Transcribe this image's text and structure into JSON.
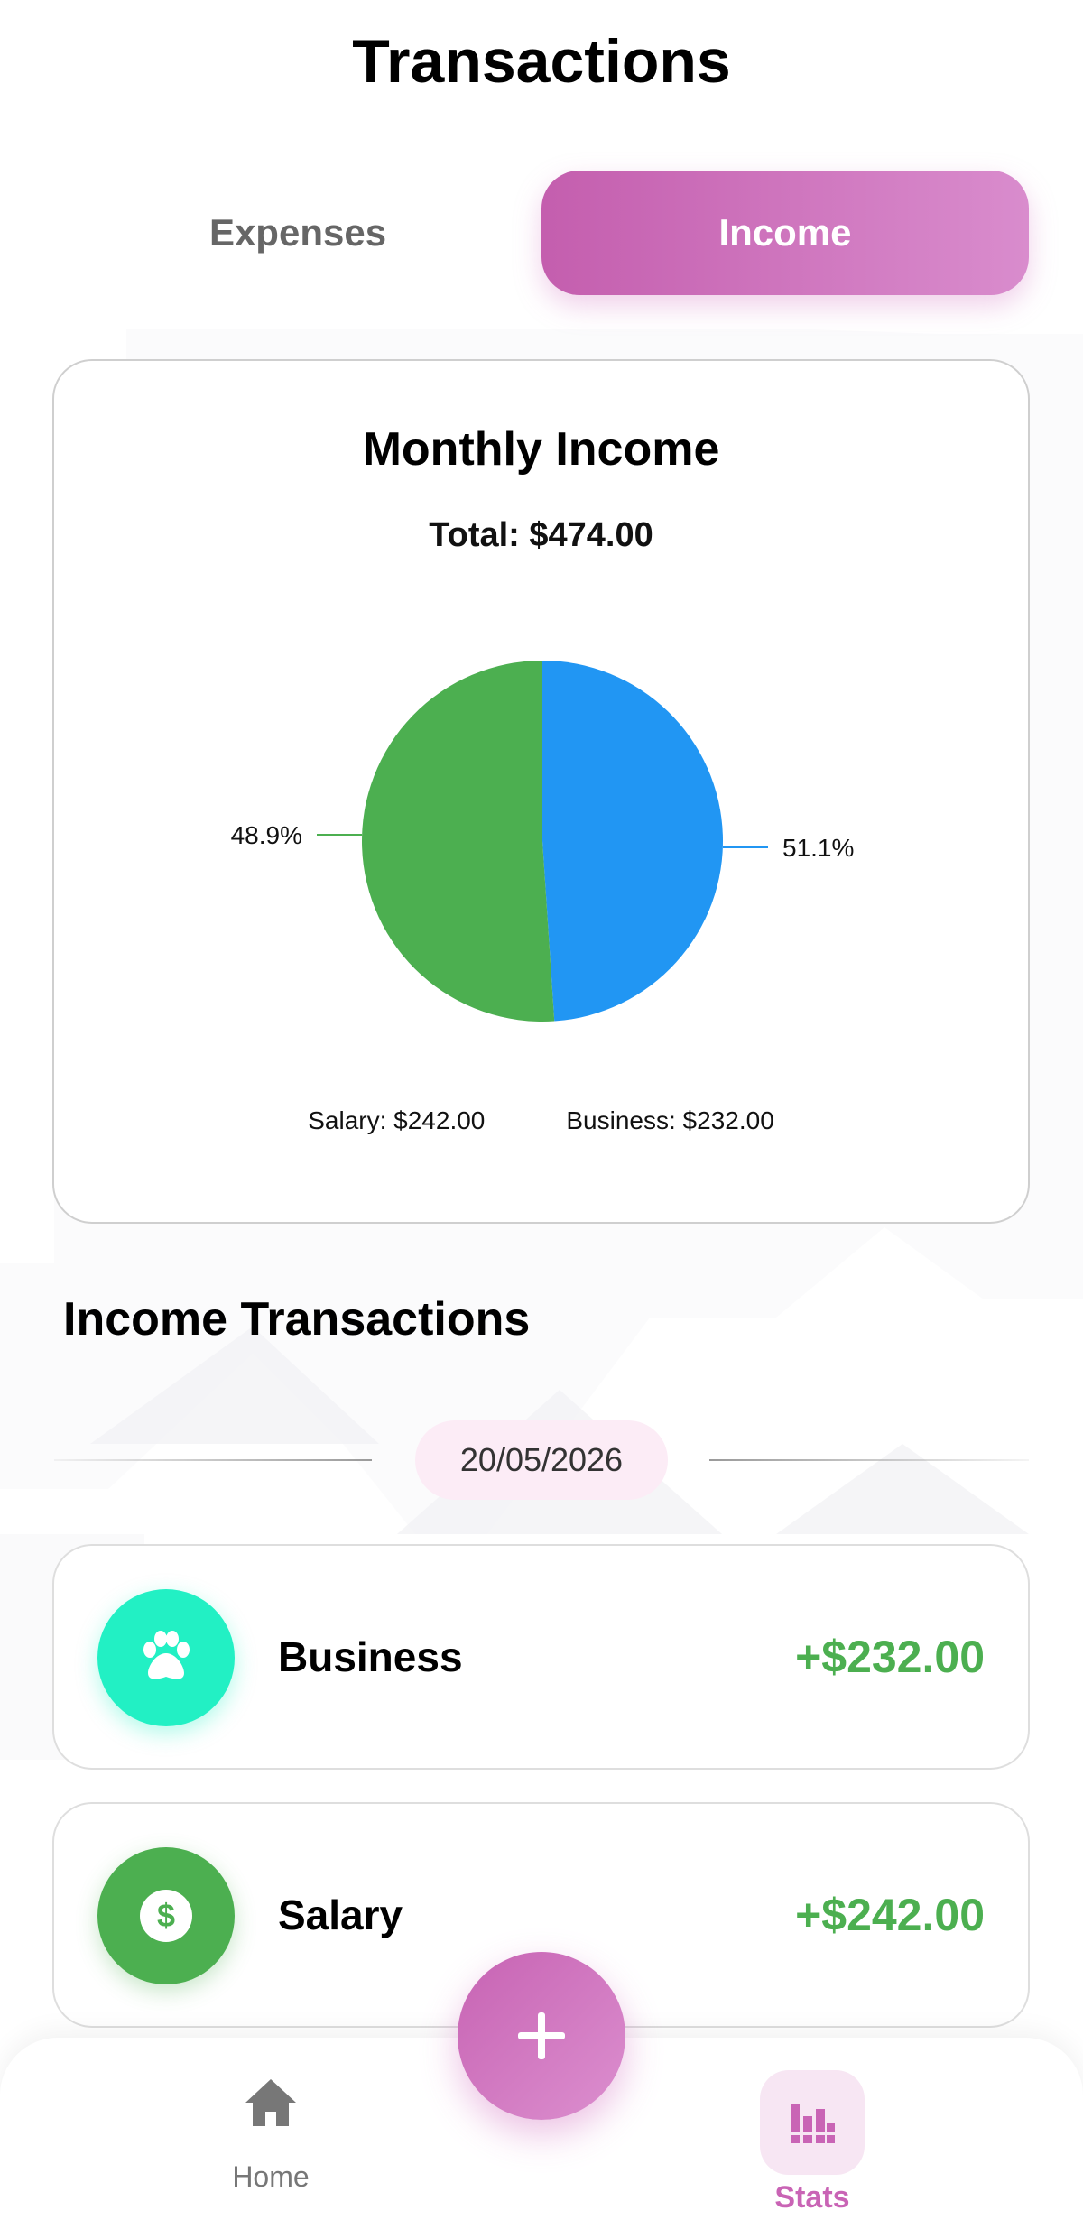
{
  "header": {
    "title": "Transactions"
  },
  "tabs": {
    "expenses_label": "Expenses",
    "income_label": "Income"
  },
  "chart_card": {
    "title": "Monthly Income",
    "total": "Total: $474.00"
  },
  "chart_data": {
    "type": "pie",
    "title": "Monthly Income",
    "slices": [
      {
        "name": "Salary",
        "value": 242.0,
        "percent_label": "48.9%",
        "color": "#4caf50"
      },
      {
        "name": "Business",
        "value": 232.0,
        "percent_label": "51.1%",
        "color": "#2196f3"
      }
    ],
    "legend": [
      "Salary: $242.00",
      "Business: $232.00"
    ]
  },
  "section": {
    "title": "Income Transactions",
    "date": "20/05/2026"
  },
  "transactions": [
    {
      "name": "Business",
      "amount": "+$232.00",
      "icon": "paw-icon",
      "icon_color": "#22f0c4"
    },
    {
      "name": "Salary",
      "amount": "+$242.00",
      "icon": "dollar-icon",
      "icon_color": "#4caf50"
    }
  ],
  "nav": {
    "home_label": "Home",
    "stats_label": "Stats"
  },
  "colors": {
    "accent": "#c964b5",
    "income_green": "#4caf50"
  }
}
